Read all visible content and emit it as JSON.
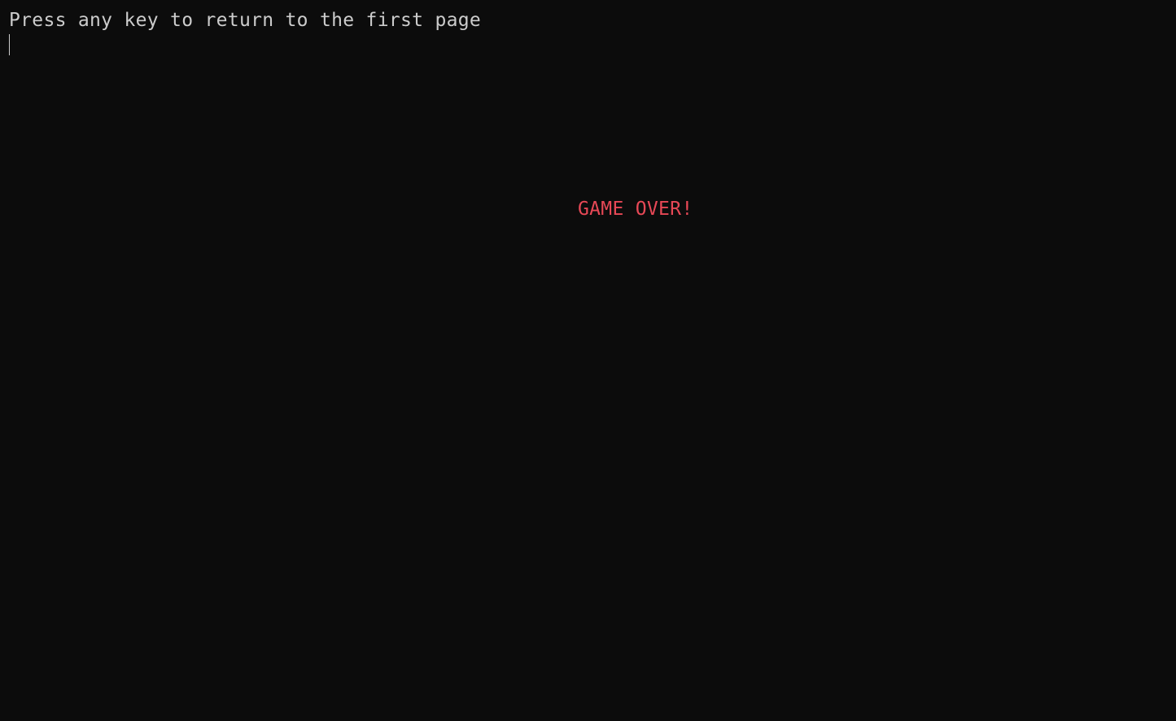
{
  "terminal": {
    "prompt_text": "Press any key to return to the first page",
    "game_over_text": "GAME OVER!",
    "colors": {
      "background": "#0c0c0c",
      "text": "#cccccc",
      "game_over": "#e74856"
    }
  }
}
